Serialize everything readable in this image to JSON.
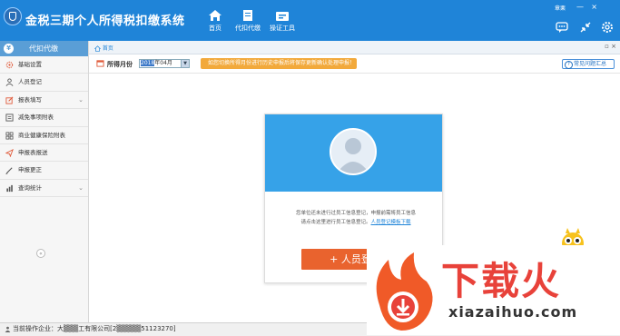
{
  "app": {
    "title": "金税三期个人所得税扣缴系统",
    "user_label": "章栗"
  },
  "top_nav": [
    {
      "label": "首页",
      "icon": "home-icon"
    },
    {
      "label": "代扣代缴",
      "icon": "document-icon"
    },
    {
      "label": "操证工具",
      "icon": "toolbox-icon"
    }
  ],
  "window_controls": {
    "minimize": "—",
    "close": "×"
  },
  "tool_icons": [
    "message-icon",
    "compress-icon",
    "settings-icon"
  ],
  "sidebar": {
    "header": "代扣代缴",
    "items": [
      {
        "label": "基础设置",
        "icon": "gear-icon",
        "has_arrow": false
      },
      {
        "label": "人员登记",
        "icon": "person-icon",
        "has_arrow": false
      },
      {
        "label": "报表填写",
        "icon": "edit-icon",
        "has_arrow": true
      },
      {
        "label": "减免事项附表",
        "icon": "form-icon",
        "has_arrow": false
      },
      {
        "label": "商业健康保险附表",
        "icon": "grid-icon",
        "has_arrow": false
      },
      {
        "label": "申报表报送",
        "icon": "send-icon",
        "has_arrow": false
      },
      {
        "label": "申报更正",
        "icon": "pen-icon",
        "has_arrow": false
      },
      {
        "label": "查询统计",
        "icon": "chart-icon",
        "has_arrow": true
      }
    ],
    "collapse": "«"
  },
  "tabbar": {
    "home_tab": "首页",
    "ctrls": "▫ ×"
  },
  "toolbar": {
    "month_label": "所得月份",
    "month_value_selected": "2018",
    "month_value_rest": "年04月",
    "notice": "如您切换所得月份进行历史申报后将保存更新确认处理申报！",
    "faq": "常见问题汇总"
  },
  "card": {
    "line1": "您单位还未进行过员工信息登记，申报前需将员工信息",
    "line2_prefix": "请点击这里进行员工信息登记。",
    "link": "人员登记模板下载",
    "button": "+ 人员登记"
  },
  "status": {
    "text": "当前操作企业：大▒▒▒工有限公司[2▒▒▒▒▒51123270]"
  },
  "watermark": {
    "big": "下载火",
    "small": "xiazaihuo.com"
  },
  "colors": {
    "topbar": "#1f84d8",
    "sidebar_header": "#5a9ed6",
    "card_top": "#36a2e8",
    "add_button": "#e9632e",
    "notice": "#f2a93b",
    "watermark_red": "#e8423a"
  }
}
